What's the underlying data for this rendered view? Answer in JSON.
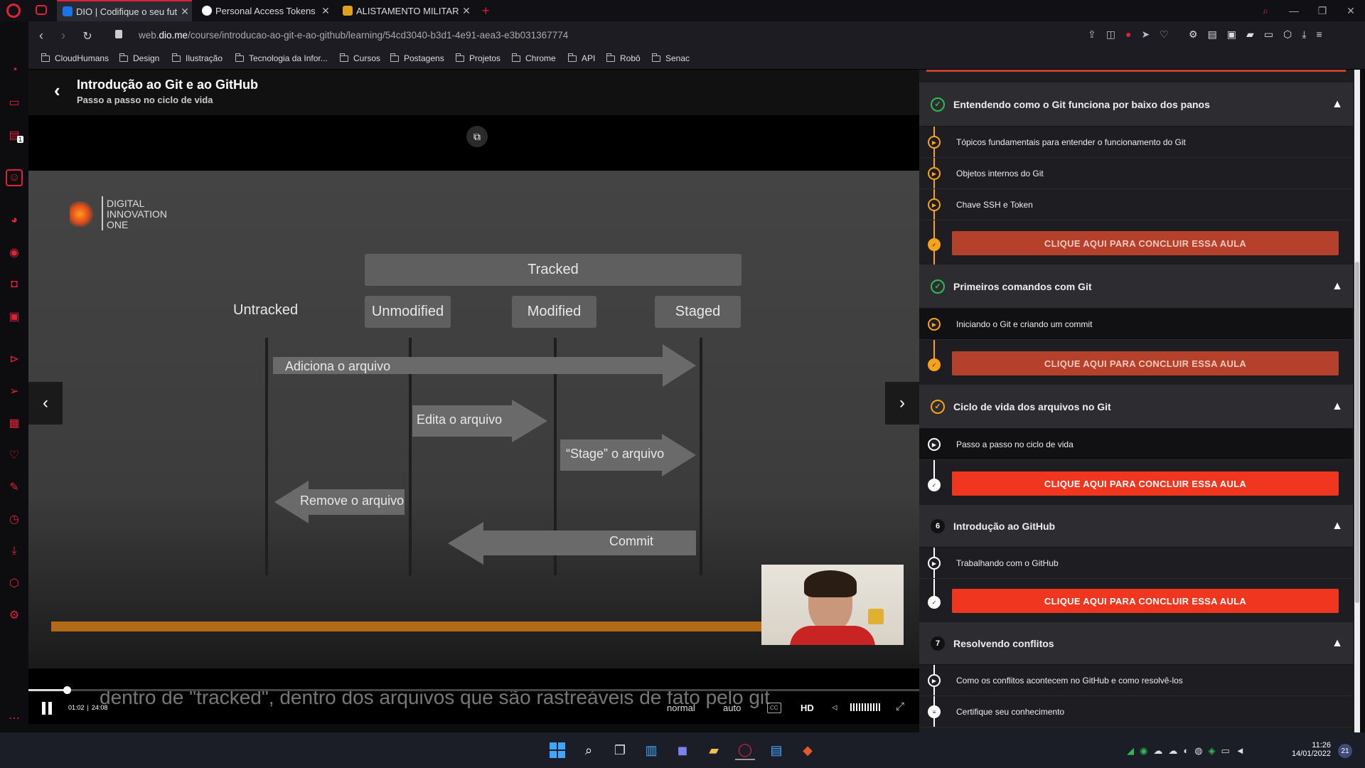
{
  "browser": {
    "tabs": [
      {
        "label": "DIO | Codifique o seu futuro",
        "active": true,
        "favicon_color": "#1a73e8"
      },
      {
        "label": "Personal Access Tokens",
        "active": false,
        "favicon_color": "#ffffff"
      },
      {
        "label": "ALISTAMENTO MILITAR ON",
        "active": false,
        "favicon_color": "#e0a020"
      }
    ],
    "new_tab": "+",
    "url_prefix": "web.",
    "url_host": "dio.me",
    "url_path": "/course/introducao-ao-git-e-ao-github/learning/54cd3040-b3d1-4e91-aea3-e3b031367774",
    "bookmarks": [
      "CloudHumans",
      "Design",
      "Ilustração",
      "Tecnologia da Infor...",
      "Cursos",
      "Postagens",
      "Projetos",
      "Chrome",
      "API",
      "Robô",
      "Senac"
    ],
    "sidebar_badge": "1"
  },
  "course": {
    "title": "Introdução ao Git e ao GitHub",
    "lesson": "Passo a passo no ciclo de vida"
  },
  "slide": {
    "logo_lines": [
      "DIGITAL",
      "INNOVATION",
      "ONE"
    ],
    "tracked": "Tracked",
    "states": [
      "Untracked",
      "Unmodified",
      "Modified",
      "Staged"
    ],
    "arrows": {
      "add": "Adiciona o arquivo",
      "edit": "Edita o arquivo",
      "stage": "“Stage” o arquivo",
      "remove": "Remove o arquivo",
      "commit": "Commit"
    }
  },
  "player": {
    "subtitle": "dentro de \"tracked\", dentro dos arquivos que são rastreáveis de fato pelo git",
    "current_time": "01:02",
    "separator": "|",
    "duration": "24:08",
    "progress": 0.043,
    "speed": "normal",
    "quality_mode": "auto",
    "cc": "CC",
    "hd": "HD"
  },
  "syllabus": {
    "cta_label": "CLIQUE AQUI PARA CONCLUIR ESSA AULA",
    "sections": [
      {
        "title": "Entendendo como o Git funciona por baixo dos panos",
        "status": "done",
        "lessons": [
          "Tópicos fundamentais para entender o funcionamento do Git",
          "Objetos internos do Git",
          "Chave SSH e Token"
        ]
      },
      {
        "title": "Primeiros comandos com Git",
        "status": "done",
        "lessons": [
          "Iniciando o Git e criando um commit"
        ]
      },
      {
        "title": "Ciclo de vida dos arquivos no Git",
        "status": "in-progress",
        "lessons": [
          "Passo a passo no ciclo de vida"
        ]
      },
      {
        "title": "Introdução ao GitHub",
        "number": "6",
        "lessons": [
          "Trabalhando com o GitHub"
        ]
      },
      {
        "title": "Resolvendo conflitos",
        "number": "7",
        "lessons": [
          "Como os conflitos acontecem no GitHub e como resolvê-los",
          "Certifique seu conhecimento"
        ]
      }
    ]
  },
  "taskbar": {
    "time": "11:26",
    "date": "14/01/2022",
    "notifications": "21"
  },
  "colors": {
    "accent": "#e0213a",
    "orange": "#f7a21b",
    "cta": "#f0361f",
    "check_green": "#2dbb55"
  }
}
